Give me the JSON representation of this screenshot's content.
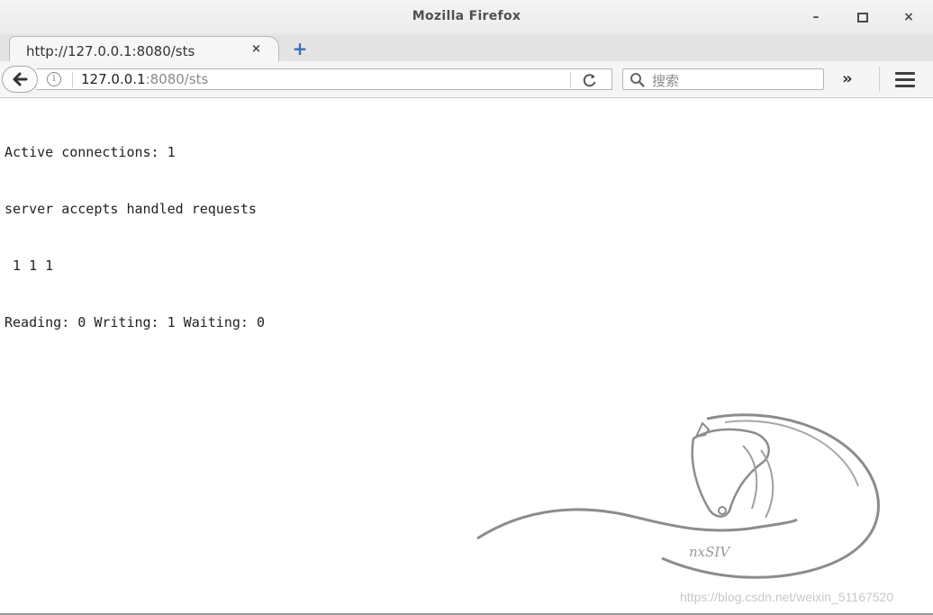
{
  "window": {
    "title": "Mozilla Firefox",
    "minimize": "–",
    "maximize": "▫",
    "close": "×"
  },
  "tab": {
    "label": "http://127.0.0.1:8080/sts",
    "close": "×"
  },
  "newtab": "+",
  "navbar": {
    "back": "←",
    "url_host": "127.0.0.1",
    "url_rest": ":8080/sts",
    "reload": "C",
    "search_placeholder": "搜索",
    "overflow": "»"
  },
  "content": {
    "lines": [
      "Active connections: 1",
      "server accepts handled requests",
      " 1 1 1",
      "Reading: 0 Writing: 1 Waiting: 0"
    ]
  },
  "watermark": "https://blog.csdn.net/weixin_51167520",
  "logo_text": "nxSIV"
}
